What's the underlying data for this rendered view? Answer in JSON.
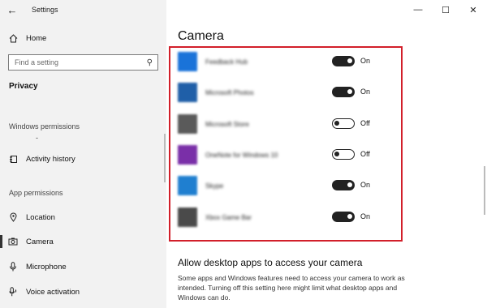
{
  "app": {
    "title": "Settings"
  },
  "sidebar": {
    "home": "Home",
    "search_placeholder": "Find a setting",
    "section": "Privacy",
    "windows_permissions": "Windows permissions",
    "dash": "-",
    "activity_history": "Activity history",
    "app_permissions": "App permissions",
    "items": [
      {
        "label": "Location",
        "icon": "location-icon"
      },
      {
        "label": "Camera",
        "icon": "camera-icon",
        "selected": true
      },
      {
        "label": "Microphone",
        "icon": "microphone-icon"
      },
      {
        "label": "Voice activation",
        "icon": "voice-activation-icon"
      }
    ]
  },
  "main": {
    "title": "Camera",
    "apps": [
      {
        "name": "Feedback Hub",
        "state": "On",
        "on": true,
        "color": "#1a73d9"
      },
      {
        "name": "Microsoft Photos",
        "state": "On",
        "on": true,
        "color": "#1f5fa8"
      },
      {
        "name": "Microsoft Store",
        "state": "Off",
        "on": false,
        "color": "#5a5a5a"
      },
      {
        "name": "OneNote for Windows 10",
        "state": "Off",
        "on": false,
        "color": "#7a2fa8"
      },
      {
        "name": "Skype",
        "state": "On",
        "on": true,
        "color": "#1f7fd0"
      },
      {
        "name": "Xbox Game Bar",
        "state": "On",
        "on": true,
        "color": "#4a4a4a"
      }
    ],
    "desktop_heading": "Allow desktop apps to access your camera",
    "desktop_desc": "Some apps and Windows features need to access your camera to work as intended. Turning off this setting here might limit what desktop apps and Windows can do."
  },
  "highlight_color": "#d21f2a"
}
